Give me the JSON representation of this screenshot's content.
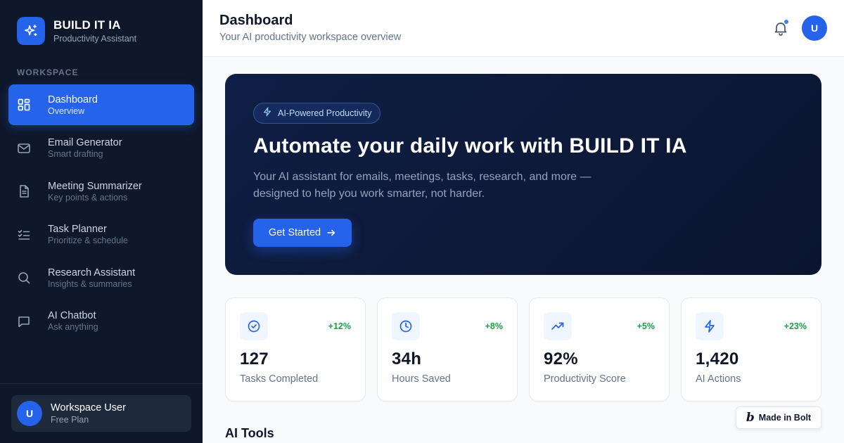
{
  "brand": {
    "title": "BUILD IT IA",
    "subtitle": "Productivity Assistant",
    "icon": "sparkles-icon"
  },
  "sidebar": {
    "section_label": "WORKSPACE",
    "items": [
      {
        "label": "Dashboard",
        "sub": "Overview",
        "icon": "grid-icon",
        "active": true
      },
      {
        "label": "Email Generator",
        "sub": "Smart drafting",
        "icon": "mail-icon"
      },
      {
        "label": "Meeting Summarizer",
        "sub": "Key points & actions",
        "icon": "document-icon"
      },
      {
        "label": "Task Planner",
        "sub": "Prioritize & schedule",
        "icon": "checklist-icon"
      },
      {
        "label": "Research Assistant",
        "sub": "Insights & summaries",
        "icon": "search-icon"
      },
      {
        "label": "AI Chatbot",
        "sub": "Ask anything",
        "icon": "chat-icon"
      }
    ],
    "user": {
      "initial": "U",
      "name": "Workspace User",
      "plan": "Free Plan"
    }
  },
  "header": {
    "title": "Dashboard",
    "subtitle": "Your AI productivity workspace overview",
    "avatar_initial": "U"
  },
  "hero": {
    "badge": "AI-Powered Productivity",
    "title": "Automate your daily work with BUILD IT IA",
    "description": "Your AI assistant for emails, meetings, tasks, research, and more — designed to help you work smarter, not harder.",
    "button": "Get Started"
  },
  "stats": [
    {
      "value": "127",
      "label": "Tasks Completed",
      "change": "+12%",
      "icon": "check-circle-icon"
    },
    {
      "value": "34h",
      "label": "Hours Saved",
      "change": "+8%",
      "icon": "clock-icon"
    },
    {
      "value": "92%",
      "label": "Productivity Score",
      "change": "+5%",
      "icon": "trending-up-icon"
    },
    {
      "value": "1,420",
      "label": "AI Actions",
      "change": "+23%",
      "icon": "lightning-icon"
    }
  ],
  "section_title": "AI Tools",
  "bolt_badge": {
    "logo": "b",
    "text": "Made in Bolt"
  },
  "colors": {
    "accent": "#2563eb",
    "sidebar_bg": "#0f172a",
    "positive": "#16a34a"
  }
}
